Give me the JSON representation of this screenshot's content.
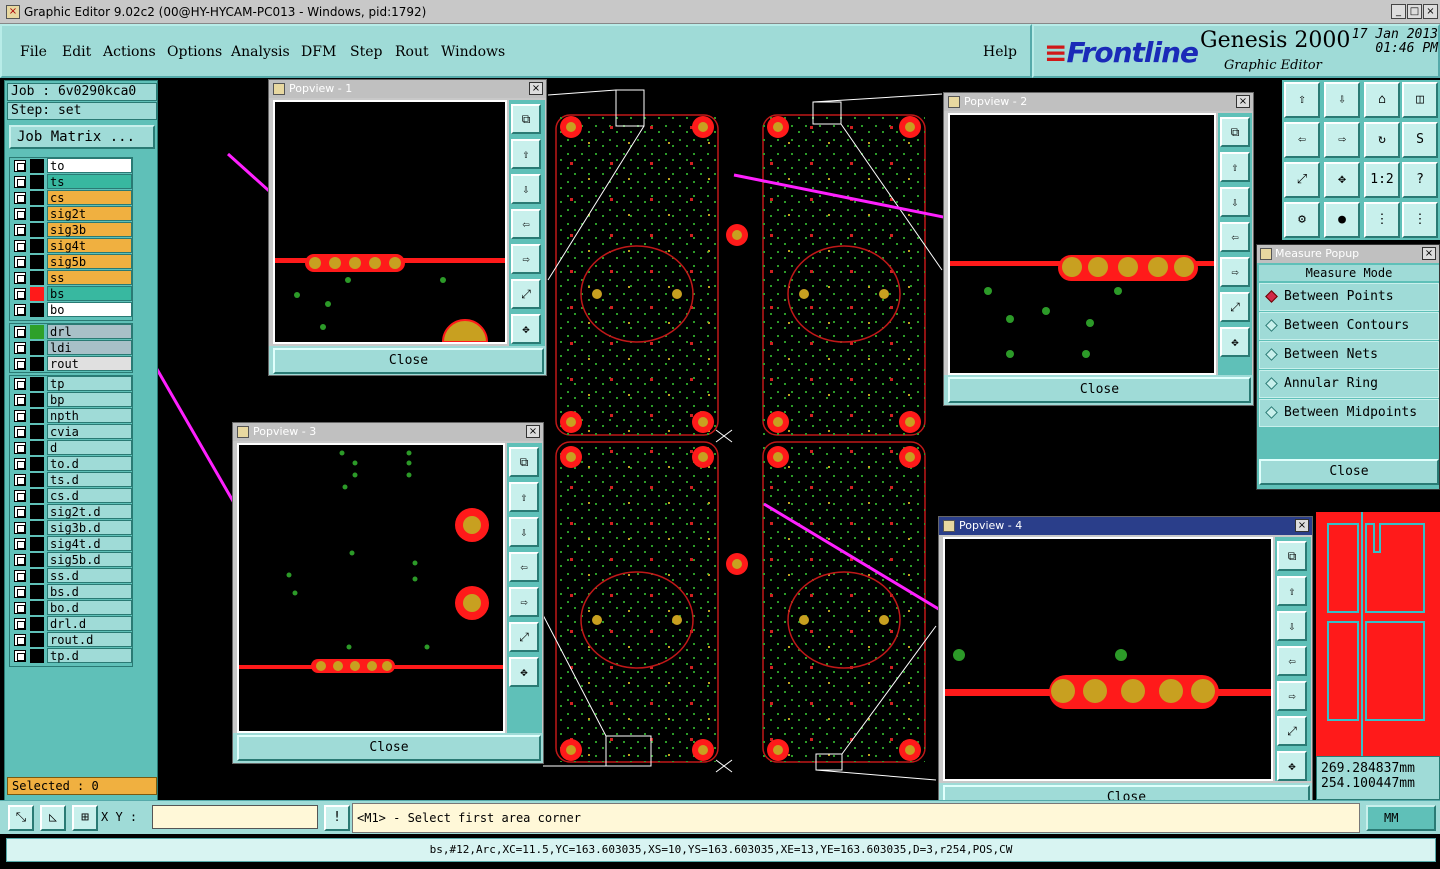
{
  "window": {
    "title": "Graphic Editor 9.02c2 (00@HY-HYCAM-PC013 - Windows, pid:1792)",
    "min": "_",
    "max": "□",
    "close": "×"
  },
  "menubar": {
    "items": [
      "File",
      "Edit",
      "Actions",
      "Options",
      "Analysis",
      "DFM",
      "Step",
      "Rout",
      "Windows"
    ],
    "help": "Help"
  },
  "brand": {
    "logo": "Frontline",
    "product": "Genesis 2000",
    "subtitle": "Graphic Editor",
    "date": "17 Jan 2013",
    "time": "01:46 PM"
  },
  "job": {
    "job": "Job : 6v0290kca0",
    "step": "Step: set",
    "matrix_button": "Job Matrix ..."
  },
  "layers": {
    "group1": [
      {
        "name": "to",
        "color": "#ffffff"
      },
      {
        "name": "ts",
        "color": "#38b8a0"
      },
      {
        "name": "cs",
        "color": "#f0b040"
      },
      {
        "name": "sig2t",
        "color": "#f0b040"
      },
      {
        "name": "sig3b",
        "color": "#f0b040"
      },
      {
        "name": "sig4t",
        "color": "#f0b040"
      },
      {
        "name": "sig5b",
        "color": "#f0b040"
      },
      {
        "name": "ss",
        "color": "#f0b040"
      },
      {
        "name": "bs",
        "color": "#38b8a0"
      },
      {
        "name": "bo",
        "color": "#ffffff"
      }
    ],
    "group2": [
      {
        "name": "drl",
        "color": "#a8c0c8"
      },
      {
        "name": "ldi",
        "color": "#a8c0c8"
      },
      {
        "name": "rout",
        "color": "#e0e0e0"
      }
    ],
    "group3": [
      {
        "name": "tp",
        "color": "#9fdbd7"
      },
      {
        "name": "bp",
        "color": "#9fdbd7"
      },
      {
        "name": "npth",
        "color": "#9fdbd7"
      },
      {
        "name": "cvia",
        "color": "#9fdbd7"
      },
      {
        "name": "d",
        "color": "#9fdbd7"
      },
      {
        "name": "to.d",
        "color": "#9fdbd7"
      },
      {
        "name": "ts.d",
        "color": "#9fdbd7"
      },
      {
        "name": "cs.d",
        "color": "#9fdbd7"
      },
      {
        "name": "sig2t.d",
        "color": "#9fdbd7"
      },
      {
        "name": "sig3b.d",
        "color": "#9fdbd7"
      },
      {
        "name": "sig4t.d",
        "color": "#9fdbd7"
      },
      {
        "name": "sig5b.d",
        "color": "#9fdbd7"
      },
      {
        "name": "ss.d",
        "color": "#9fdbd7"
      },
      {
        "name": "bs.d",
        "color": "#9fdbd7"
      },
      {
        "name": "bo.d",
        "color": "#9fdbd7"
      },
      {
        "name": "drl.d",
        "color": "#9fdbd7"
      },
      {
        "name": "rout.d",
        "color": "#9fdbd7"
      },
      {
        "name": "tp.d",
        "color": "#9fdbd7"
      }
    ],
    "selected": "Selected : 0"
  },
  "popviews": [
    {
      "title": "Popview - 1",
      "close": "Close"
    },
    {
      "title": "Popview - 2",
      "close": "Close"
    },
    {
      "title": "Popview - 3",
      "close": "Close"
    },
    {
      "title": "Popview - 4",
      "close": "Close"
    }
  ],
  "measure": {
    "title": "Measure Popup",
    "mode_label": "Measure Mode",
    "options": [
      "Between Points",
      "Between Contours",
      "Between Nets",
      "Annular Ring",
      "Between Midpoints"
    ],
    "selected_index": 0,
    "close": "Close"
  },
  "coords": {
    "x": "269.284837mm",
    "y": "254.100447mm"
  },
  "bottom": {
    "xy_label": "X Y :",
    "xy_value": "",
    "prompt": "<M1> - Select first area corner",
    "units": "MM"
  },
  "status": "bs,#12,Arc,XC=11.5,YC=163.603035,XS=10,YS=163.603035,XE=13,YE=163.603035,D=3,r254,POS,CW",
  "colors": {
    "panel": "#5fc0b8",
    "panel_light": "#9fdbd7",
    "copper": "#ff1a1a",
    "pad": "#c8a020",
    "highlight": "#ff20ff"
  }
}
